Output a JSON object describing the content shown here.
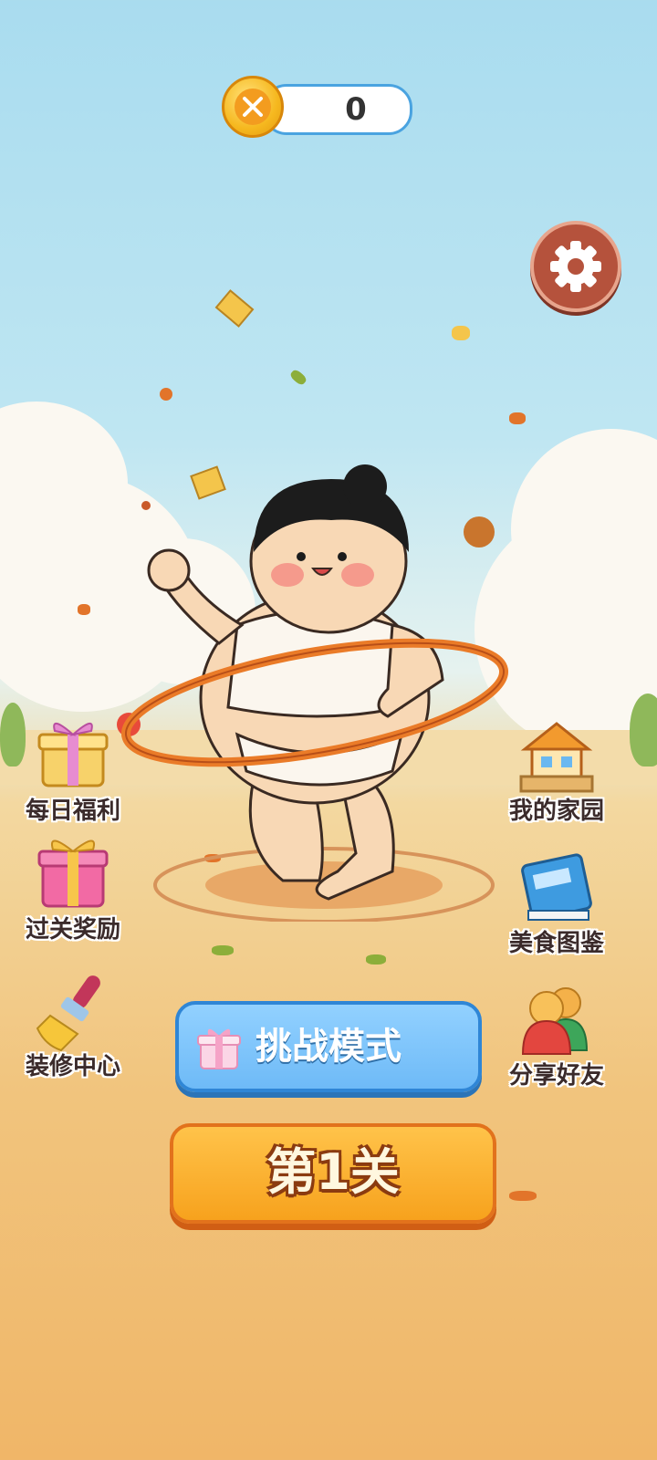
{
  "coins": {
    "value": "0",
    "icon": "fork-knife-coin-icon"
  },
  "settings": {
    "icon": "gear-icon"
  },
  "left_menu": [
    {
      "label": "每日福利",
      "icon": "gift-box-icon"
    },
    {
      "label": "过关奖励",
      "icon": "gift-box-pink-icon"
    },
    {
      "label": "装修中心",
      "icon": "paint-brush-icon"
    }
  ],
  "right_menu": [
    {
      "label": "我的家园",
      "icon": "house-icon"
    },
    {
      "label": "美食图鉴",
      "icon": "book-icon"
    },
    {
      "label": "分享好友",
      "icon": "friends-icon"
    }
  ],
  "challenge": {
    "label": "挑战模式",
    "icon": "gift-icon"
  },
  "level": {
    "label": "第1关"
  },
  "colors": {
    "sky": "#a9dcef",
    "ground": "#f1c47d",
    "challenge": "#6ebaf7",
    "level": "#f7a21d",
    "settings": "#b5523c"
  }
}
